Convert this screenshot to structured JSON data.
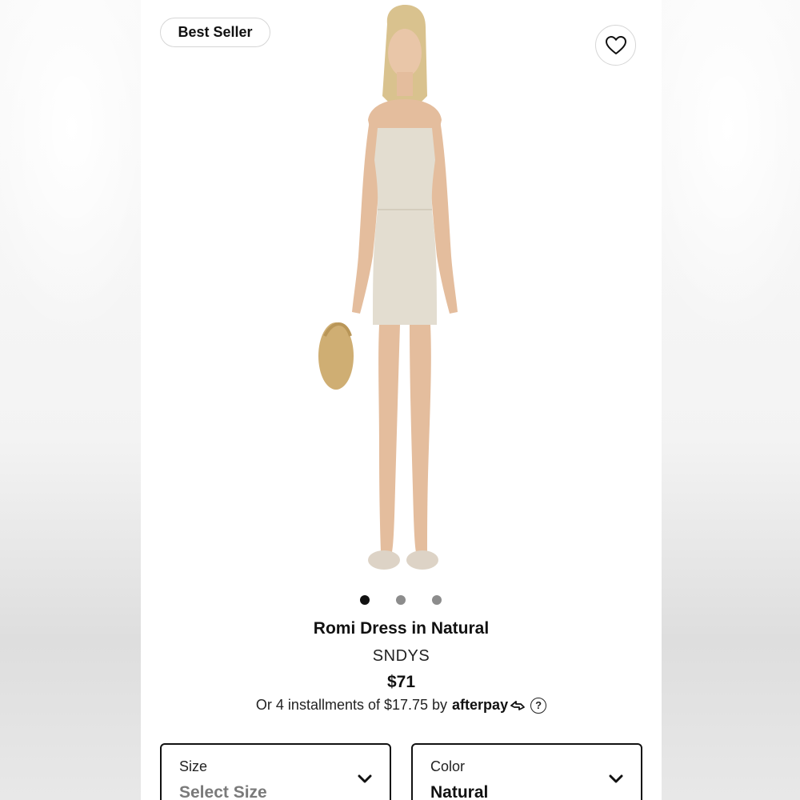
{
  "badge": {
    "label": "Best Seller"
  },
  "wishlist": {
    "icon": "heart-icon"
  },
  "gallery": {
    "total_images": 3,
    "active_index": 0
  },
  "product": {
    "title": "Romi Dress in Natural",
    "brand": "SNDYS",
    "price": "$71",
    "installments_text": "Or 4 installments of $17.75 by",
    "afterpay_label": "afterpay",
    "help_icon": "question-circle-icon"
  },
  "selectors": {
    "size": {
      "label": "Size",
      "value": "Select Size"
    },
    "color": {
      "label": "Color",
      "value": "Natural"
    }
  },
  "colors": {
    "text": "#111111",
    "border": "#d6d6d6",
    "dot_inactive": "#8c8c8c"
  }
}
